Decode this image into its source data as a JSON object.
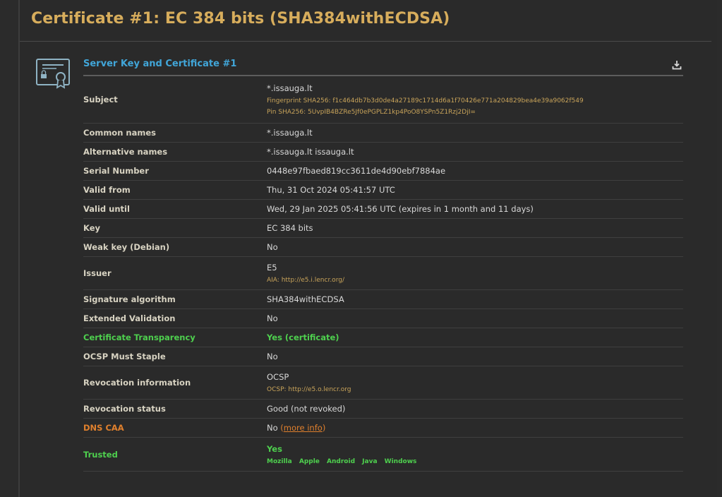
{
  "page": {
    "title": "Certificate #1: EC 384 bits (SHA384withECDSA)"
  },
  "section": {
    "title": "Server Key and Certificate #1",
    "icons": {
      "certificate": "certificate-icon",
      "download": "download-icon"
    }
  },
  "rows": {
    "subject": {
      "label": "Subject",
      "value": "*.issauga.lt",
      "fingerprint": "Fingerprint SHA256: f1c464db7b3d0de4a27189c1714d6a1f70426e771a204829bea4e39a9062f549",
      "pin": "Pin SHA256: 5UvpIB4BZRe5Jf0ePGPLZ1kp4PoO8YSPn5Z1Rzj2DjI="
    },
    "common_names": {
      "label": "Common names",
      "value": "*.issauga.lt"
    },
    "alternative_names": {
      "label": "Alternative names",
      "value": "*.issauga.lt issauga.lt"
    },
    "serial_number": {
      "label": "Serial Number",
      "value": "0448e97fbaed819cc3611de4d90ebf7884ae"
    },
    "valid_from": {
      "label": "Valid from",
      "value": "Thu, 31 Oct 2024 05:41:57 UTC"
    },
    "valid_until": {
      "label": "Valid until",
      "value": "Wed, 29 Jan 2025 05:41:56 UTC (expires in 1 month and 11 days)"
    },
    "key": {
      "label": "Key",
      "value": "EC 384 bits"
    },
    "weak_key": {
      "label": "Weak key (Debian)",
      "value": "No"
    },
    "issuer": {
      "label": "Issuer",
      "value": "E5",
      "aia": "AIA: http://e5.i.lencr.org/"
    },
    "signature_algorithm": {
      "label": "Signature algorithm",
      "value": "SHA384withECDSA"
    },
    "extended_validation": {
      "label": "Extended Validation",
      "value": "No"
    },
    "certificate_transparency": {
      "label": "Certificate Transparency",
      "value": "Yes (certificate)"
    },
    "ocsp_must_staple": {
      "label": "OCSP Must Staple",
      "value": "No"
    },
    "revocation_information": {
      "label": "Revocation information",
      "value": "OCSP",
      "ocsp": "OCSP: http://e5.o.lencr.org"
    },
    "revocation_status": {
      "label": "Revocation status",
      "value": "Good (not revoked)"
    },
    "dns_caa": {
      "label": "DNS CAA",
      "value": "No",
      "link_open": "(",
      "link": "more info",
      "link_close": ")"
    },
    "trusted": {
      "label": "Trusted",
      "value": "Yes",
      "stores": [
        "Mozilla",
        "Apple",
        "Android",
        "Java",
        "Windows"
      ]
    }
  },
  "colors": {
    "title": "#d7ad5c",
    "section_title": "#41a6d9",
    "green": "#4ed04e",
    "orange": "#e0802d",
    "sub_text": "#c9a45a"
  }
}
